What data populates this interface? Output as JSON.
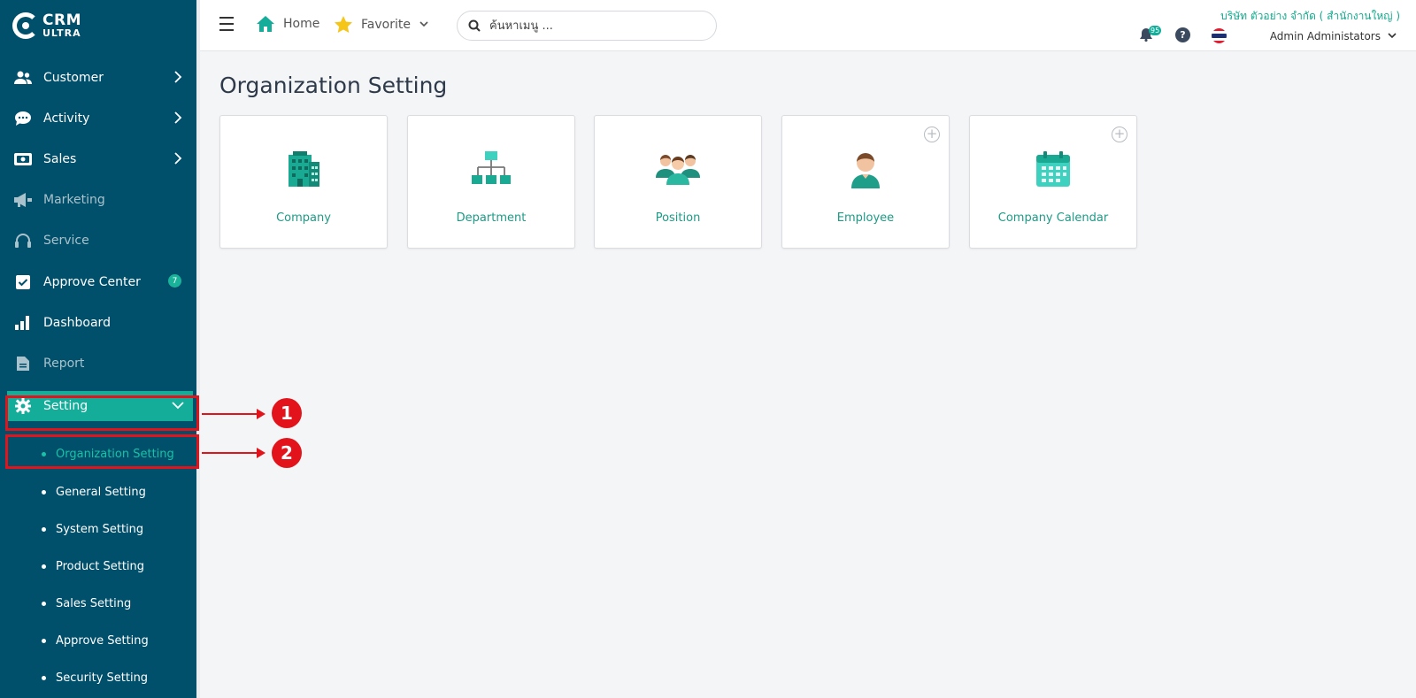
{
  "app": {
    "logo_line1": "CRM",
    "logo_line2": "ULTRA"
  },
  "sidebar": {
    "items": [
      {
        "label": "Customer",
        "icon": "users-icon"
      },
      {
        "label": "Activity",
        "icon": "chat-icon"
      },
      {
        "label": "Sales",
        "icon": "cash-icon"
      },
      {
        "label": "Marketing",
        "icon": "megaphone-icon"
      },
      {
        "label": "Service",
        "icon": "headset-icon"
      },
      {
        "label": "Approve Center",
        "icon": "check-square-icon",
        "badge": "7"
      },
      {
        "label": "Dashboard",
        "icon": "bar-chart-icon"
      },
      {
        "label": "Report",
        "icon": "document-icon"
      },
      {
        "label": "Setting",
        "icon": "gear-icon"
      }
    ],
    "setting_sub": [
      "Organization Setting",
      "General Setting",
      "System Setting",
      "Product Setting",
      "Sales Setting",
      "Approve Setting",
      "Security Setting"
    ]
  },
  "topbar": {
    "home": "Home",
    "favorite": "Favorite",
    "search_placeholder": "ค้นหาเมนู ...",
    "company": "บริษัท ตัวอย่าง จำกัด ( สำนักงานใหญ่ )",
    "notification_count": "95",
    "help": "?",
    "user": "Admin Administators"
  },
  "main": {
    "title": "Organization Setting",
    "cards": [
      {
        "label": "Company",
        "icon": "building-icon"
      },
      {
        "label": "Department",
        "icon": "org-chart-icon"
      },
      {
        "label": "Position",
        "icon": "people-group-icon"
      },
      {
        "label": "Employee",
        "icon": "person-icon"
      },
      {
        "label": "Company Calendar",
        "icon": "calendar-icon"
      }
    ]
  },
  "annotations": {
    "step1": "1",
    "step2": "2"
  },
  "colors": {
    "sidebar_bg": "#004f6b",
    "accent": "#14ad9a",
    "highlight": "#e3131b"
  }
}
